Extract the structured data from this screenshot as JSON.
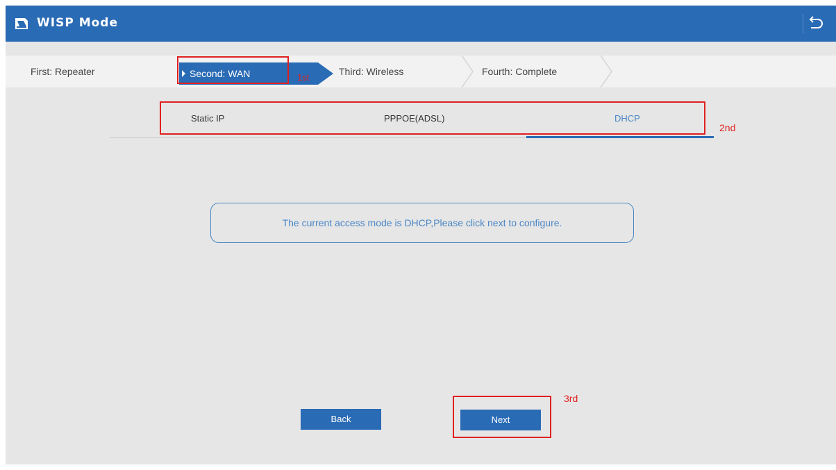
{
  "header": {
    "title": "WISP Mode",
    "icon": "router-icon",
    "back_icon": "return-arrow-icon"
  },
  "steps": [
    {
      "label": "First: Repeater",
      "active": false
    },
    {
      "label": "Second: WAN",
      "active": true
    },
    {
      "label": "Third: Wireless",
      "active": false
    },
    {
      "label": "Fourth: Complete",
      "active": false
    }
  ],
  "wan_tabs": [
    {
      "label": "Static IP",
      "active": false
    },
    {
      "label": "PPPOE(ADSL)",
      "active": false
    },
    {
      "label": "DHCP",
      "active": true
    }
  ],
  "message": "The current access mode is DHCP,Please click next to configure.",
  "buttons": {
    "back": "Back",
    "next": "Next"
  },
  "annotations": {
    "first": "1st",
    "second": "2nd",
    "third": "3rd"
  },
  "colors": {
    "primary": "#2a6bb5",
    "background": "#e6e6e6",
    "annotation": "#e02020",
    "active_text": "#4a86c5"
  }
}
